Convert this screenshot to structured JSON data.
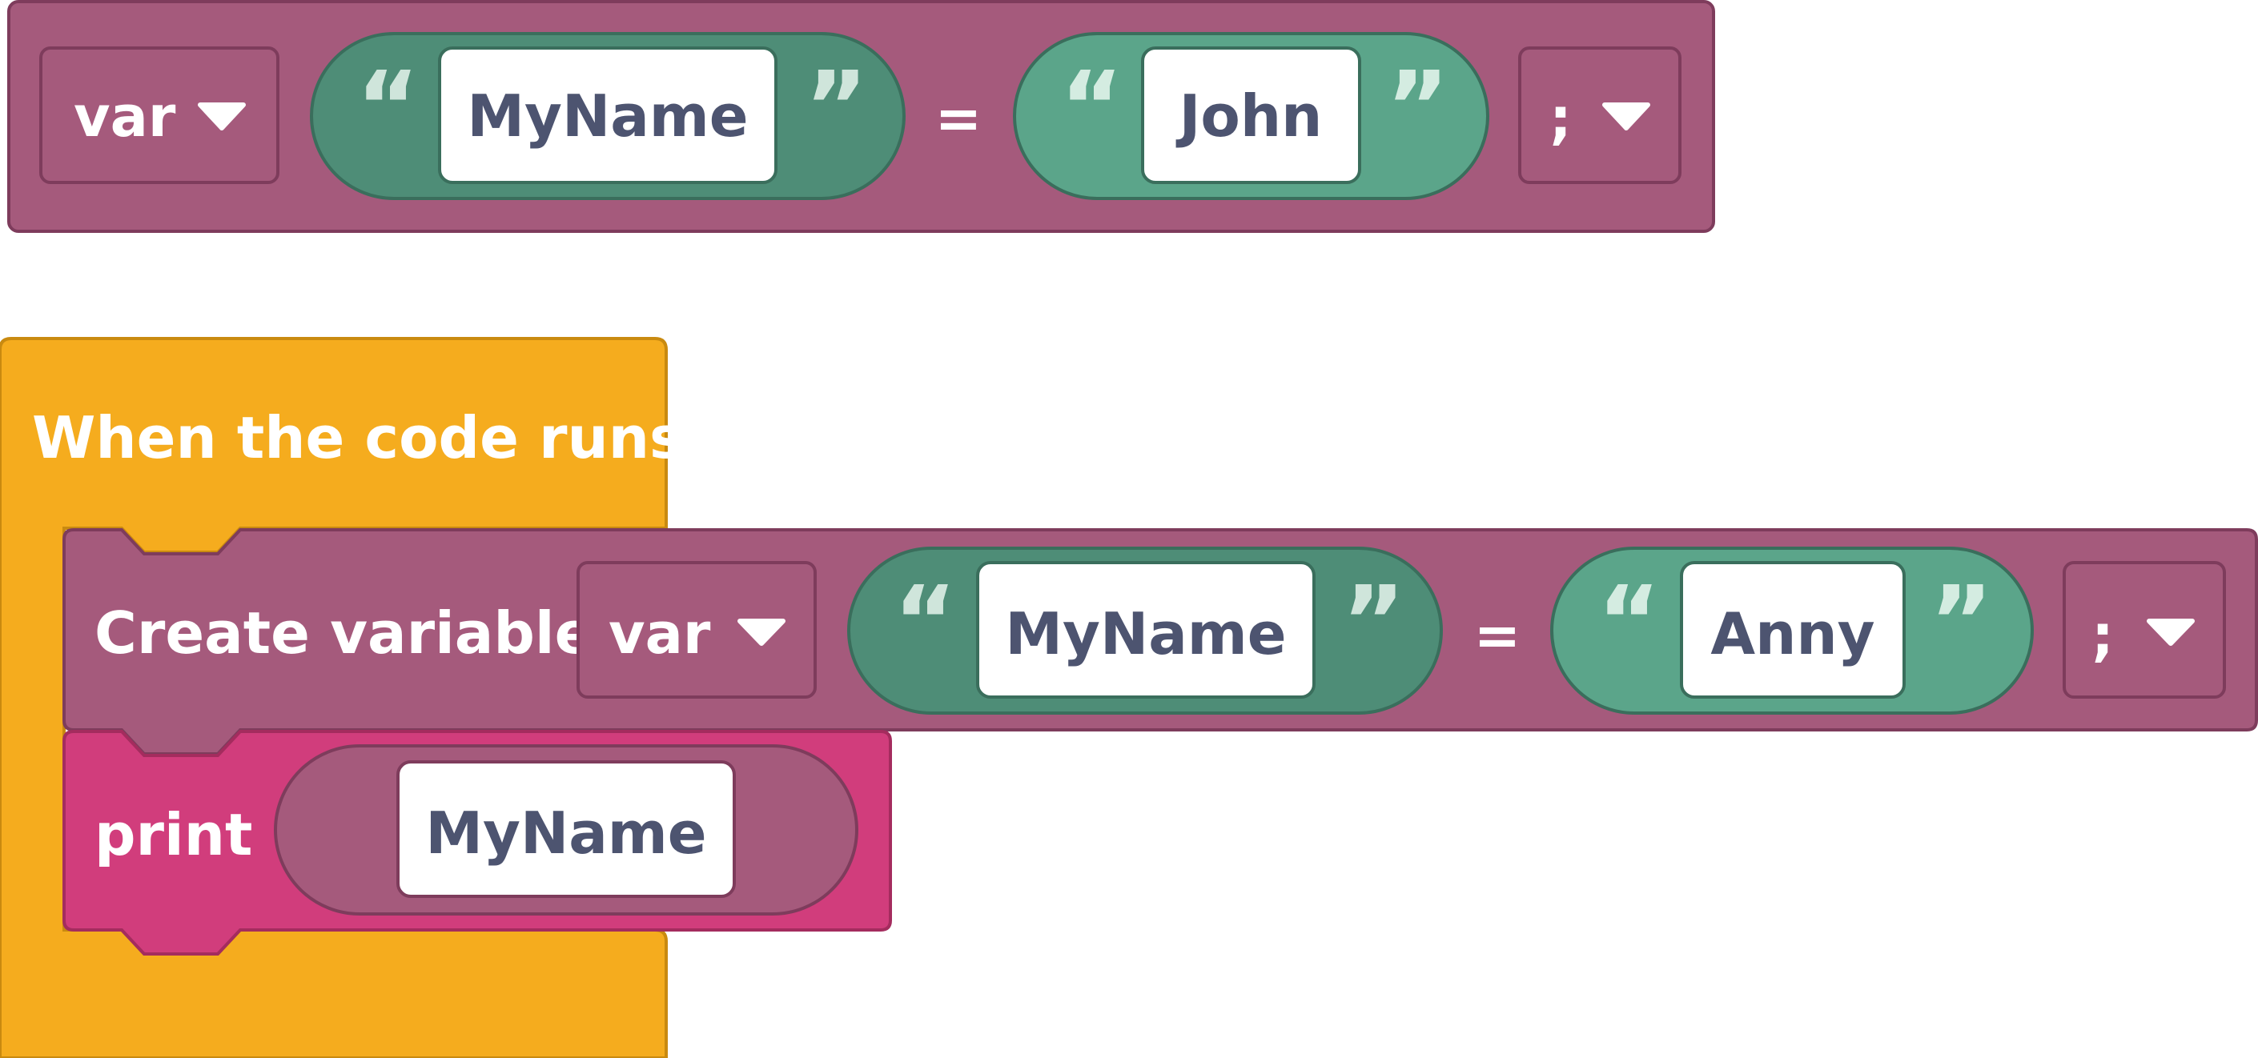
{
  "top_block": {
    "var_label": "var",
    "var_name": "MyName",
    "equals": "=",
    "value": "John",
    "terminator": ";"
  },
  "event_block": {
    "label": "When the code runs"
  },
  "create_block": {
    "label": "Create variable",
    "var_label": "var",
    "var_name": "MyName",
    "equals": "=",
    "value": "Anny",
    "terminator": ";"
  },
  "print_block": {
    "label": "print",
    "arg": "MyName"
  },
  "quote_open": "“",
  "quote_close": "”",
  "colors": {
    "variable_block": "#a55a7c",
    "variable_border": "#7e3c5c",
    "string_pill_dark": "#4e8d77",
    "string_pill_light": "#5ba58a",
    "string_border": "#3a6e5c",
    "event_block": "#f5ac1e",
    "event_border": "#c98a10",
    "print_block": "#d13d7c",
    "print_border": "#a42c5e",
    "field_text": "#4d5470",
    "block_text": "#ffffff"
  }
}
